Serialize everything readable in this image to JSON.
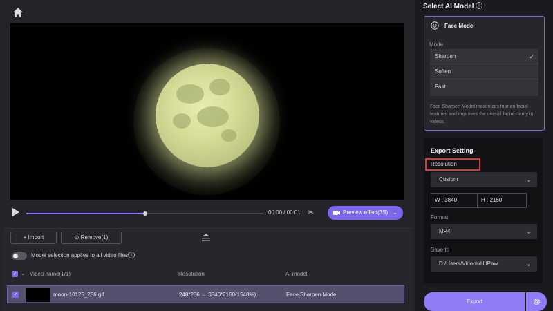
{
  "player": {
    "time": "00:00 / 00:01",
    "preview_label": "Preview effect(3S)",
    "progress": 0.5
  },
  "file_panel": {
    "import_label": "Import",
    "remove_label": "Remove(1)",
    "toggle_label": "Model selection applies to all video files",
    "columns": {
      "name": "Video name(1/1)",
      "resolution": "Resolution",
      "model": "AI model"
    },
    "rows": [
      {
        "name": "moon-10125_256.gif",
        "resolution": "248*256 → 3840*2160(1548%)",
        "model": "Face Sharpen Model"
      }
    ]
  },
  "ai_model": {
    "title": "Select AI Model",
    "card_title": "Face Model",
    "mode_label": "Mode",
    "modes": [
      "Sharpen",
      "Soften",
      "Fast"
    ],
    "selected_mode": "Sharpen",
    "description": "Face Sharpen Model maximizes human facial features and improves the overall facial clarity in videos."
  },
  "export": {
    "title": "Export Setting",
    "resolution_label": "Resolution",
    "resolution_value": "Custom",
    "width_text": "W : 3840",
    "height_text": "H : 2160",
    "format_label": "Format",
    "format_value": "MP4",
    "save_label": "Save to",
    "save_path": "D:/Users/Videos/HitPaw",
    "button_label": "Export"
  },
  "colors": {
    "accent": "#7b68ee",
    "highlight": "#d63a3a"
  }
}
